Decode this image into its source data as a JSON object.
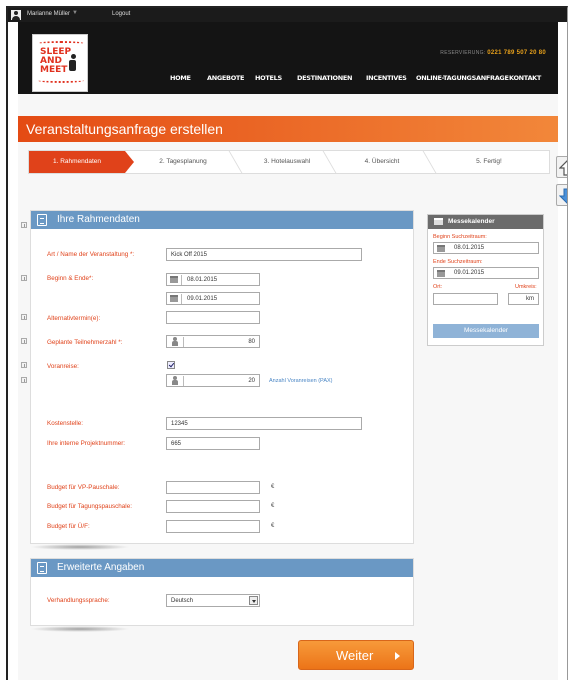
{
  "user_bar": {
    "user": "Marianne Müller",
    "caret": "▼",
    "logout": "Logout"
  },
  "header": {
    "logo": {
      "line1": "SLEEP",
      "line2": "AND",
      "line3": "MEET"
    },
    "reservation_label": "RESERVIERUNG:",
    "reservation_number": "0221 789 507 20 80",
    "nav": [
      "HOME",
      "ANGEBOTE",
      "HOTELS",
      "DESTINATIONEN",
      "INCENTIVES",
      "ONLINE-TAGUNGSANFRAGE",
      "KONTAKT"
    ]
  },
  "page_title": "Veranstaltungsanfrage erstellen",
  "steps": [
    "1. Rahmendaten",
    "2. Tagesplanung",
    "3. Hotelauswahl",
    "4. Übersicht",
    "5. Fertig!"
  ],
  "active_step": 0,
  "rahmendaten": {
    "heading": "Ihre Rahmendaten",
    "name_label": "Art / Name der Veranstaltung *:",
    "name_value": "Kick Off 2015",
    "dates_label": "Beginn & Ende*:",
    "date_start": "08.01.2015",
    "date_end": "09.01.2015",
    "alt_label": "Alternativtermin(e):",
    "alt_value": "",
    "participants_label": "Geplante Teilnehmerzahl *:",
    "participants_value": "80",
    "pre_label": "Voranreise:",
    "pre_checked": true,
    "pre_value": "20",
    "pre_link": "Anzahl Voranreisen (PAX)",
    "cost_label": "Kostenstelle:",
    "cost_value": "12345",
    "project_label": "Ihre interne Projektnummer:",
    "project_value": "665",
    "budget_vp_label": "Budget für VP-Pauschale:",
    "budget_tp_label": "Budget für Tagungspauschale:",
    "budget_uf_label": "Budget für Ü/F:",
    "currency": "€"
  },
  "erweitert": {
    "heading": "Erweiterte Angaben",
    "lang_label": "Verhandlungssprache:",
    "lang_value": "Deutsch"
  },
  "messekalender": {
    "heading": "Messekalender",
    "start_label": "Beginn Suchzeitraum:",
    "start_value": "08.01.2015",
    "end_label": "Ende Suchzeitraum:",
    "end_value": "09.01.2015",
    "ort_label": "Ort:",
    "umkreis_label": "Umkreis:",
    "unit": "km",
    "button": "Messekalender"
  },
  "weiter_button": "Weiter",
  "colors": {
    "accent": "#e0421a",
    "panel_head": "#6a98c4",
    "button": "#ec7418"
  }
}
